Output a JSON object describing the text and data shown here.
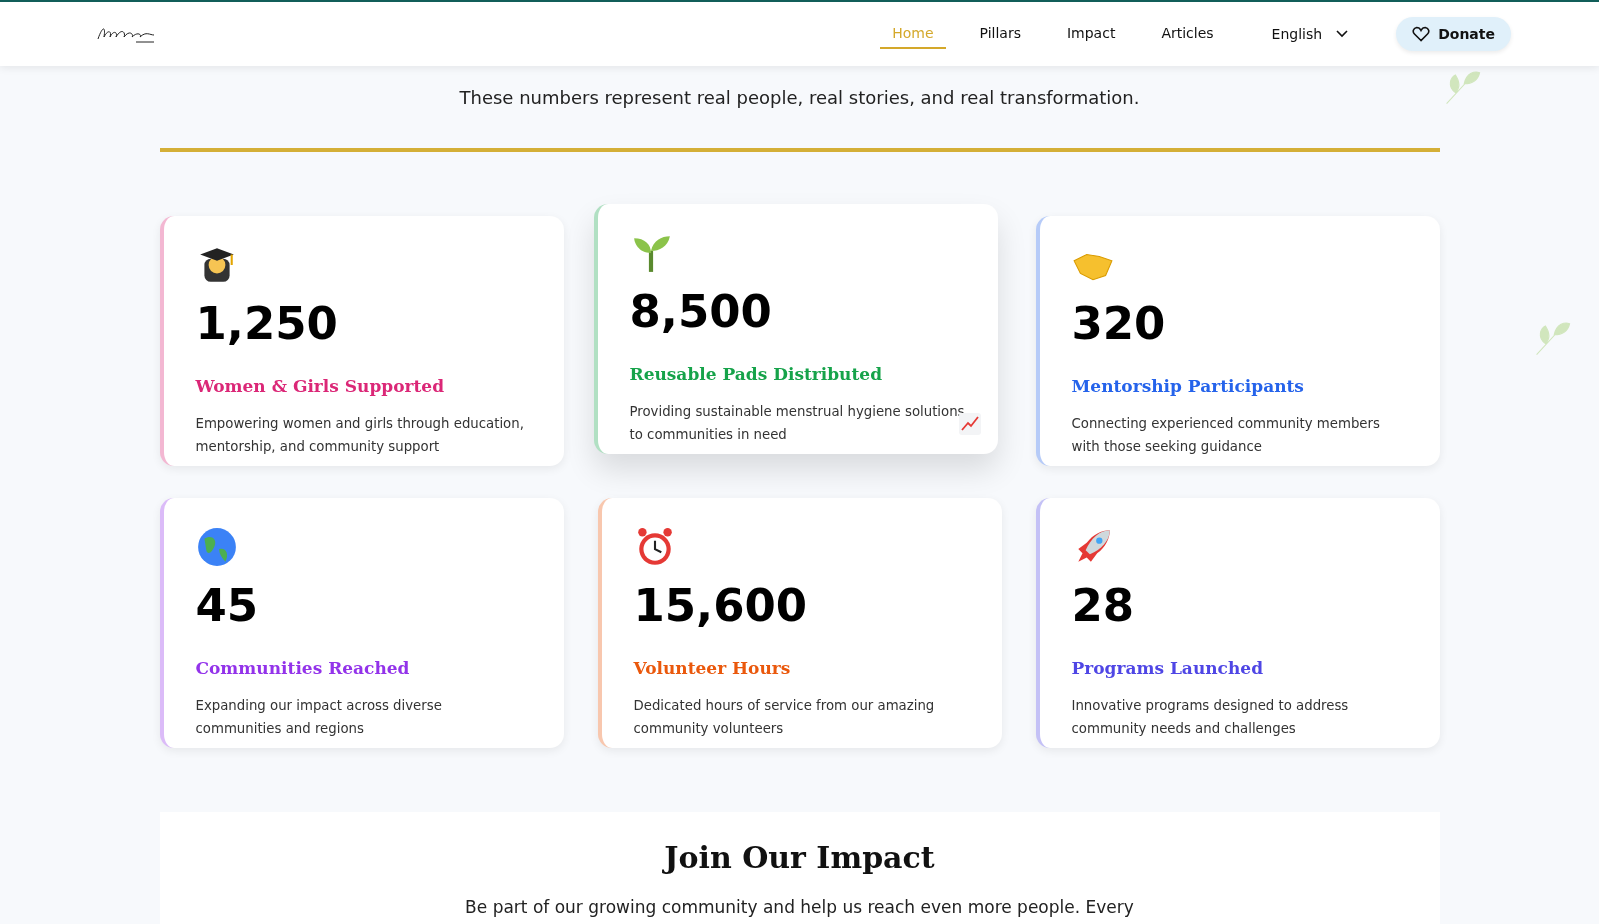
{
  "nav": {
    "items": [
      {
        "label": "Home",
        "selected": true
      },
      {
        "label": "Pillars",
        "selected": false
      },
      {
        "label": "Impact",
        "selected": false
      },
      {
        "label": "Articles",
        "selected": false
      }
    ],
    "language": "English",
    "donate": "Donate"
  },
  "intro": [
    "These numbers represent real people, real stories, and real transformation."
  ],
  "stats": [
    {
      "value": "1,250",
      "title": "Women & Girls Supported",
      "description": "Empowering women and girls through education, mentorship, and community support",
      "color": "#db2777",
      "raised": false
    },
    {
      "value": "8,500",
      "title": "Reusable Pads Distributed",
      "description": "Providing sustainable menstrual hygiene solutions to communities in need",
      "color": "#16a34a",
      "raised": true
    },
    {
      "value": "320",
      "title": "Mentorship Participants",
      "description": "Connecting experienced community members with those seeking guidance",
      "color": "#2563eb",
      "raised": false
    },
    {
      "value": "45",
      "title": "Communities Reached",
      "description": "Expanding our impact across diverse communities and regions",
      "color": "#9333ea",
      "raised": false
    },
    {
      "value": "15,600",
      "title": "Volunteer Hours",
      "description": "Dedicated hours of service from our amazing community volunteers",
      "color": "#ea580c",
      "raised": false
    },
    {
      "value": "28",
      "title": "Programs Launched",
      "description": "Innovative programs designed to address community needs and challenges",
      "color": "#4f46e5",
      "raised": false
    }
  ],
  "join": {
    "title": "Join Our Impact",
    "text": "Be part of our growing community and help us reach even more people. Every"
  }
}
